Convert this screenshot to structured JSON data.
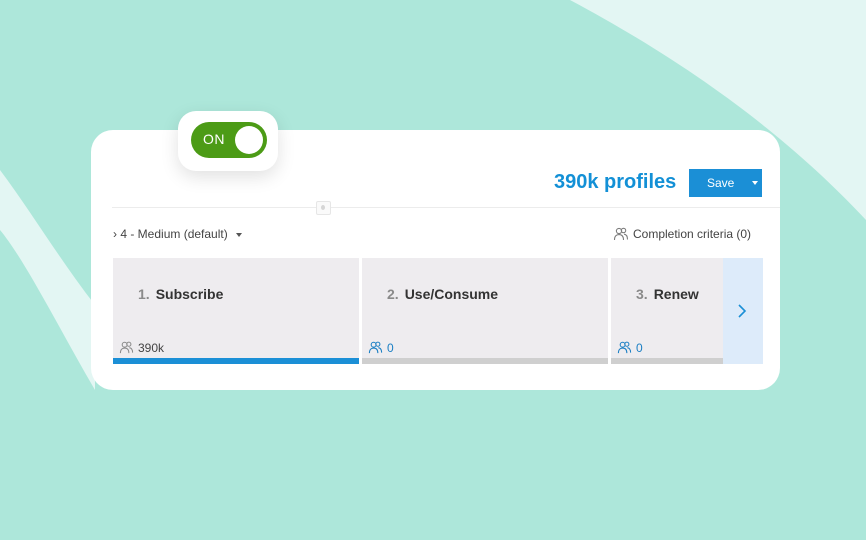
{
  "toggle": {
    "label": "ON",
    "state": "on",
    "color": "#4c9b16"
  },
  "header": {
    "profiles_count": "390k profiles",
    "save_label": "Save"
  },
  "scope": {
    "selected": "4 - Medium (default)"
  },
  "completion_criteria": "Completion criteria (0)",
  "stages": [
    {
      "number": "1.",
      "title": "Subscribe",
      "count": "390k",
      "active": true
    },
    {
      "number": "2.",
      "title": "Use/Consume",
      "count": "0",
      "active": false
    },
    {
      "number": "3.",
      "title": "Renew",
      "count": "0",
      "active": false
    }
  ],
  "colors": {
    "background": "#ade7da",
    "accent": "#1b8fd6",
    "stage_active_bar": "#1b8fd6",
    "stage_inactive_bar": "#cfcfcf"
  },
  "icons": {
    "profiles": "users-icon",
    "next": "chevron-right-icon",
    "dropdown": "caret-down-icon"
  }
}
